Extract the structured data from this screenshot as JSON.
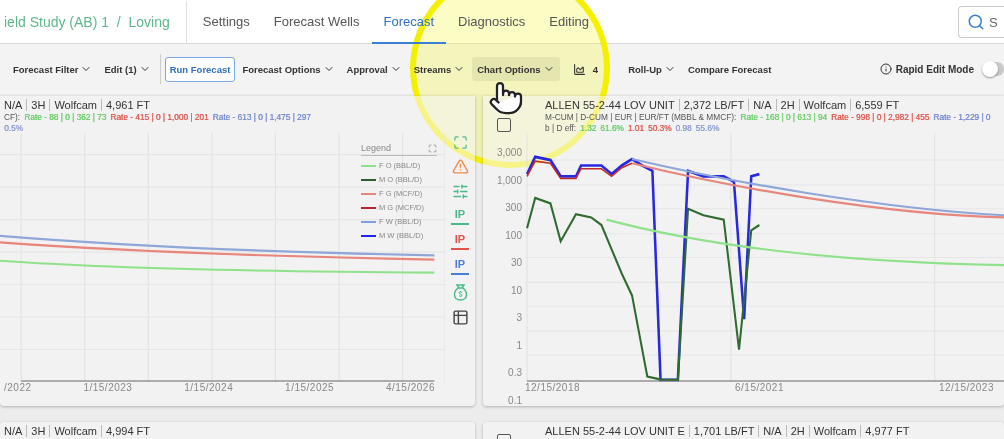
{
  "breadcrumb": {
    "project": "ield Study (AB) 1",
    "separator": "/",
    "item": "Loving"
  },
  "tabs": [
    {
      "label": "Settings",
      "selected": false
    },
    {
      "label": "Forecast Wells",
      "selected": false
    },
    {
      "label": "Forecast",
      "selected": true
    },
    {
      "label": "Diagnostics",
      "selected": false
    },
    {
      "label": "Editing",
      "selected": false
    }
  ],
  "search": {
    "placeholder": "S"
  },
  "toolbar": [
    {
      "kind": "menu",
      "label": "Forecast Filter"
    },
    {
      "kind": "menu",
      "label": "Edit (1)"
    },
    {
      "kind": "divider"
    },
    {
      "kind": "primary",
      "label": "Run Forecast"
    },
    {
      "kind": "menu",
      "label": "Forecast Options"
    },
    {
      "kind": "menu",
      "label": "Approval"
    },
    {
      "kind": "menu",
      "label": "Streams"
    },
    {
      "kind": "hovered",
      "label": "Chart Options"
    },
    {
      "kind": "count",
      "label": "4"
    },
    {
      "kind": "menu",
      "label": "Roll-Up"
    },
    {
      "kind": "plain",
      "label": "Compare Forecast"
    }
  ],
  "rapid_edit": {
    "label": "Rapid Edit Mode",
    "on": false
  },
  "wells": [
    {
      "title": [
        "N/A",
        "3H",
        "Wolfcam",
        "4,961 FT"
      ],
      "stats_prefix": "CF):",
      "groups": [
        {
          "color": "#6fcf6f",
          "text": "Rate - 88 | 0 | 362 | 73"
        },
        {
          "color": "#e0605a",
          "text": "Rate - 415 | 0 | 1,000 | 201"
        },
        {
          "color": "#7b8fd0",
          "text": "Rate - 613 | 0 | 1,475 | 297"
        }
      ],
      "eff": [
        {
          "color": "#8f9fd0",
          "value": "0.5%"
        }
      ],
      "side_icons": [
        {
          "kind": "warning"
        },
        {
          "kind": "sliders"
        },
        {
          "kind": "ip",
          "label": "IP",
          "color": "#4cbb8a"
        },
        {
          "kind": "ip",
          "label": "IP",
          "color": "#e0544c"
        },
        {
          "kind": "ip",
          "label": "IP",
          "color": "#4a7fd4"
        },
        {
          "kind": "money"
        },
        {
          "kind": "table"
        }
      ],
      "chart": {
        "kind": "linear",
        "xticks": [
          "/2022",
          "1/15/2023",
          "1/15/2024",
          "1/15/2025",
          "4/15/2026"
        ],
        "legend": {
          "title": "Legend",
          "items": [
            {
              "label": "F O (BBL/D)",
              "color": "#8fe28a"
            },
            {
              "label": "M O (BBL/D)",
              "color": "#2f5d2f"
            },
            {
              "label": "F G (MCF/D)",
              "color": "#e8857c"
            },
            {
              "label": "M G (MCF/D)",
              "color": "#b0282a"
            },
            {
              "label": "F W (BBL/D)",
              "color": "#7f9fd8"
            },
            {
              "label": "M W (BBL/D)",
              "color": "#2222ee"
            }
          ]
        }
      }
    },
    {
      "checkbox": false,
      "title": [
        "ALLEN 55-2-44 LOV UNIT",
        "2,372 LB/FT",
        "N/A",
        "2H",
        "Wolfcam",
        "6,559 FT"
      ],
      "stats_prefix": "M-CUM | D-CUM | EUR | EUR/FT (MBBL & MMCF):",
      "groups": [
        {
          "color": "#6fcf6f",
          "text": "Rate - 168 | 0 | 613 | 94"
        },
        {
          "color": "#e0605a",
          "text": "Rate - 998 | 0 | 2,982 | 455"
        },
        {
          "color": "#7b8fd0",
          "text": "Rate - 1,229 | 0"
        }
      ],
      "eff_prefix": "b | D eff:",
      "eff": [
        {
          "color": "#6fcf6f",
          "value": "1.32"
        },
        {
          "color": "#6fcf6f",
          "value": "61.6%"
        },
        {
          "color": "#e0605a",
          "value": "1.01"
        },
        {
          "color": "#e0605a",
          "value": "50.3%"
        },
        {
          "color": "#8f9fd0",
          "value": "0.98"
        },
        {
          "color": "#8f9fd0",
          "value": "55.6%"
        }
      ],
      "chart": {
        "kind": "log",
        "xticks": [
          "12/15/2018",
          "6/15/2021",
          "12/15/2023"
        ],
        "yticks": [
          "3,000",
          "1,000",
          "300",
          "100",
          "30",
          "10",
          "3",
          "1",
          "0.3",
          "0.1"
        ]
      }
    }
  ],
  "next_wells": [
    {
      "title": [
        "N/A",
        "3H",
        "Wolfcam",
        "4,994 FT"
      ]
    },
    {
      "checkbox": false,
      "title": [
        "ALLEN 55-2-44 LOV UNIT E",
        "1,701 LB/FT",
        "N/A",
        "2H",
        "Wolfcam",
        "4,977 FT"
      ]
    }
  ],
  "spotlight": true
}
